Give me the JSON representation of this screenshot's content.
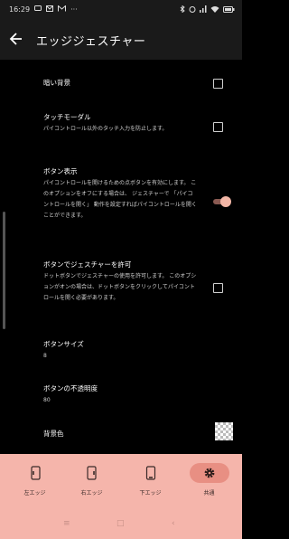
{
  "status_bar": {
    "time": "16:29",
    "left_icons": [
      "sms-icon",
      "mail-icon",
      "gmail-icon",
      "more-icon"
    ],
    "right_icons": [
      "bluetooth-icon",
      "alarm-icon",
      "signal-icon",
      "wifi-icon",
      "battery-icon"
    ]
  },
  "app_bar": {
    "title": "エッジジェスチャー"
  },
  "settings": {
    "dim_background": {
      "title": "暗い背景",
      "checked": false
    },
    "touch_modal": {
      "title": "タッチモーダル",
      "desc": "パイコントロール以外のタッチ入力を防止します。",
      "checked": false
    },
    "show_button": {
      "title": "ボタン表示",
      "desc": "パイコントロールを開けるための点ボタンを有効にします。 このオプションをオフにする場合は、 ジェスチャーで 「パイコントロールを開く」 動作を設定すればパイコントロールを開くことができます。",
      "enabled": true
    },
    "button_gesture": {
      "title": "ボタンでジェスチャーを許可",
      "desc": "ドットボタンでジェスチャーの使用を許可します。 このオプションがオンの場合は、ドットボタンをクリックしてパイコントロールを開く必要があります。",
      "checked": false
    },
    "button_size": {
      "title": "ボタンサイズ",
      "value": "8"
    },
    "button_opacity": {
      "title": "ボタンの不透明度",
      "value": "80"
    },
    "background_color": {
      "title": "背景色"
    }
  },
  "bottom_nav": {
    "items": [
      {
        "label": "左エッジ",
        "icon": "left-edge-icon"
      },
      {
        "label": "右エッジ",
        "icon": "right-edge-icon"
      },
      {
        "label": "下エッジ",
        "icon": "bottom-edge-icon"
      },
      {
        "label": "共通",
        "icon": "gear-icon",
        "active": true
      }
    ]
  },
  "colors": {
    "accent": "#f5b5ab",
    "toggle_thumb": "#f2b6a6",
    "background": "#000000"
  }
}
